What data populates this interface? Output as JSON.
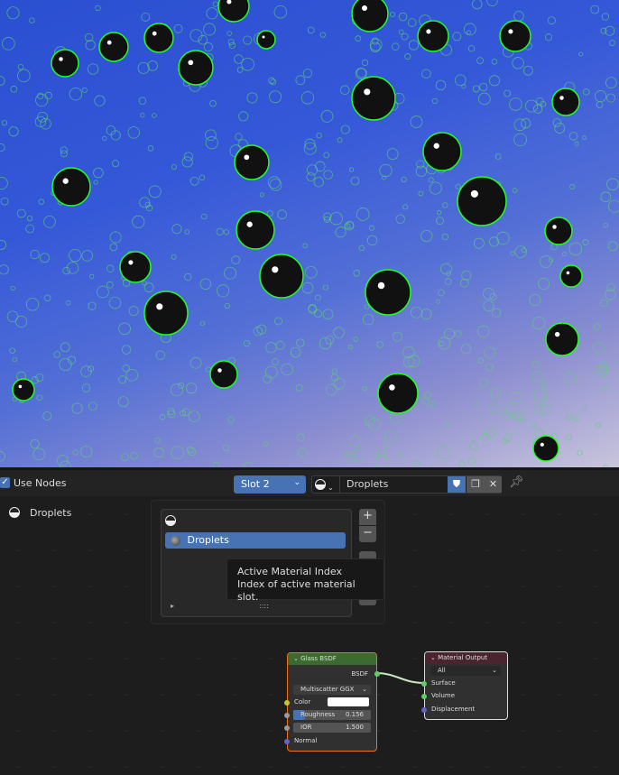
{
  "header": {
    "use_nodes_label": "Use Nodes",
    "use_nodes_checked": true,
    "slot_label": "Slot 2",
    "material_name": "Droplets"
  },
  "sidebar": {
    "material_label": "Droplets"
  },
  "slot_popup": {
    "items": [
      {
        "label": ""
      },
      {
        "label": "Droplets",
        "active": true
      }
    ],
    "add_label": "+",
    "remove_label": "−",
    "grip": "::::",
    "expand": "▸"
  },
  "tooltip": {
    "title": "Active Material Index",
    "description": "Index of active material slot."
  },
  "glass_node": {
    "title": "Glass BSDF",
    "output": "BSDF",
    "distribution": "Multiscatter GGX",
    "color_label": "Color",
    "roughness_label": "Roughness",
    "roughness_value": "0.156",
    "roughness": 0.156,
    "ior_label": "IOR",
    "ior_value": "1.500",
    "normal_label": "Normal"
  },
  "output_node": {
    "title": "Material Output",
    "target": "All",
    "inputs": [
      "Surface",
      "Volume",
      "Displacement"
    ]
  },
  "colors": {
    "accent": "#4772b3",
    "selection_outline": "#00ff00",
    "glass_header": "#3b6b30",
    "output_header": "#4a2530",
    "node_active": "#f07020"
  }
}
